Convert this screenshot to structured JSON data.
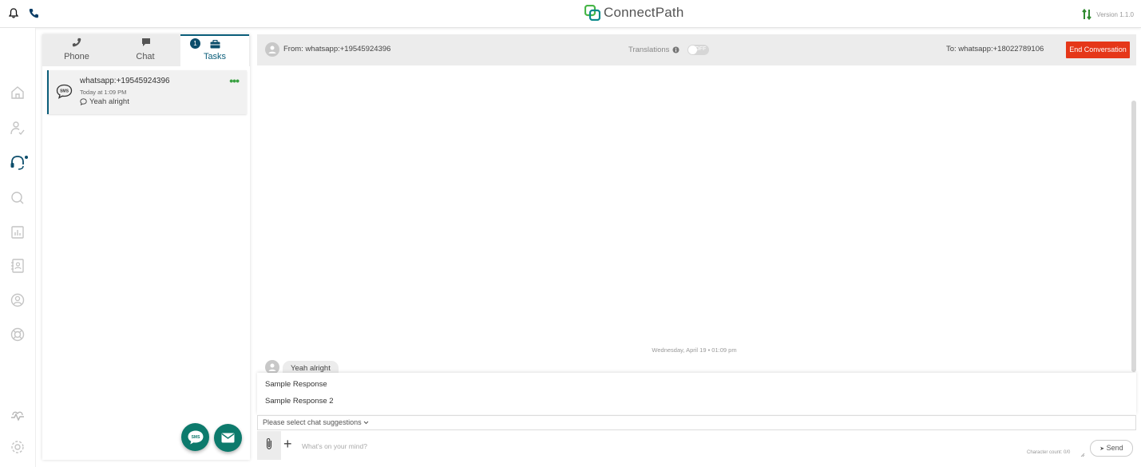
{
  "header": {
    "logo_text": "ConnectPath",
    "version": "Version 1.1.0",
    "colors": {
      "logo_green": "#48b648",
      "logo_teal": "#0b8a8a",
      "version_arrows": "#2f8a2f"
    }
  },
  "topbar": {
    "icons": [
      "bell-icon",
      "phone-icon"
    ]
  },
  "nav": {
    "icons": [
      "home-icon",
      "users-icon",
      "headset-icon",
      "search-icon",
      "reports-icon",
      "contacts-icon",
      "profile-icon",
      "help-icon",
      "activity-icon",
      "settings-icon"
    ]
  },
  "tabs": [
    {
      "label": "Phone",
      "icon": "phone-icon"
    },
    {
      "label": "Chat",
      "icon": "chat-icon"
    },
    {
      "label": "Tasks",
      "icon": "briefcase-icon",
      "badge": "1"
    }
  ],
  "task": {
    "title": "whatsapp:+19545924396",
    "time": "Today at 1:09 PM",
    "last_message": "Yeah alright"
  },
  "conversation": {
    "from": "From: whatsapp:+19545924396",
    "translations_label": "Translations",
    "toggle_state": "OFF",
    "to": "To: whatsapp:+18022789106",
    "end_button": "End Conversation",
    "date_stamp": "Wednesday, April 19 • 01:09 pm",
    "messages": [
      {
        "text": "Yeah alright"
      }
    ]
  },
  "suggestions": {
    "items": [
      "Sample Response",
      "Sample Response 2"
    ],
    "select_label": "Please select chat suggestions"
  },
  "composer": {
    "placeholder": "What's on your mind?",
    "char_count": "Character count: 0/0",
    "send_label": "Send"
  },
  "colors": {
    "accent": "#0b5e7a",
    "danger": "#e53719",
    "fab": "#0d7a6c",
    "dots": "#3aa142"
  }
}
